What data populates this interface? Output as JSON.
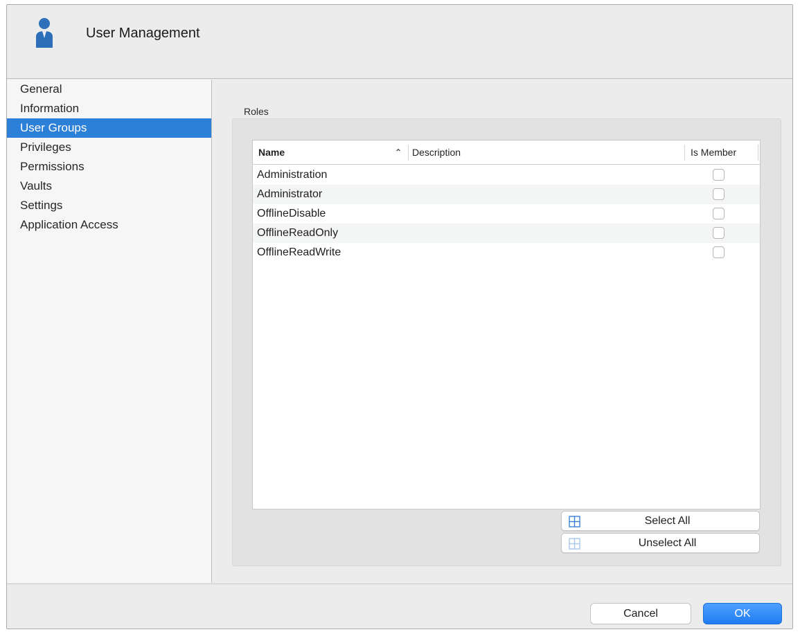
{
  "header": {
    "title": "User Management",
    "icon": "user-icon"
  },
  "sidebar": {
    "items": [
      {
        "label": "General",
        "selected": false
      },
      {
        "label": "Information",
        "selected": false
      },
      {
        "label": "User Groups",
        "selected": true
      },
      {
        "label": "Privileges",
        "selected": false
      },
      {
        "label": "Permissions",
        "selected": false
      },
      {
        "label": "Vaults",
        "selected": false
      },
      {
        "label": "Settings",
        "selected": false
      },
      {
        "label": "Application Access",
        "selected": false
      }
    ]
  },
  "roles": {
    "label": "Roles",
    "columns": {
      "name": "Name",
      "description": "Description",
      "is_member": "Is Member"
    },
    "rows": [
      {
        "name": "Administration",
        "description": "",
        "is_member": false
      },
      {
        "name": "Administrator",
        "description": "",
        "is_member": false
      },
      {
        "name": "OfflineDisable",
        "description": "",
        "is_member": false
      },
      {
        "name": "OfflineReadOnly",
        "description": "",
        "is_member": false
      },
      {
        "name": "OfflineReadWrite",
        "description": "",
        "is_member": false
      }
    ],
    "select_all": "Select All",
    "unselect_all": "Unselect All"
  },
  "footer": {
    "cancel": "Cancel",
    "ok": "OK"
  },
  "colors": {
    "accent": "#2c80d8",
    "ok_button": "#1f7cf2",
    "window_bg": "#ececec"
  }
}
